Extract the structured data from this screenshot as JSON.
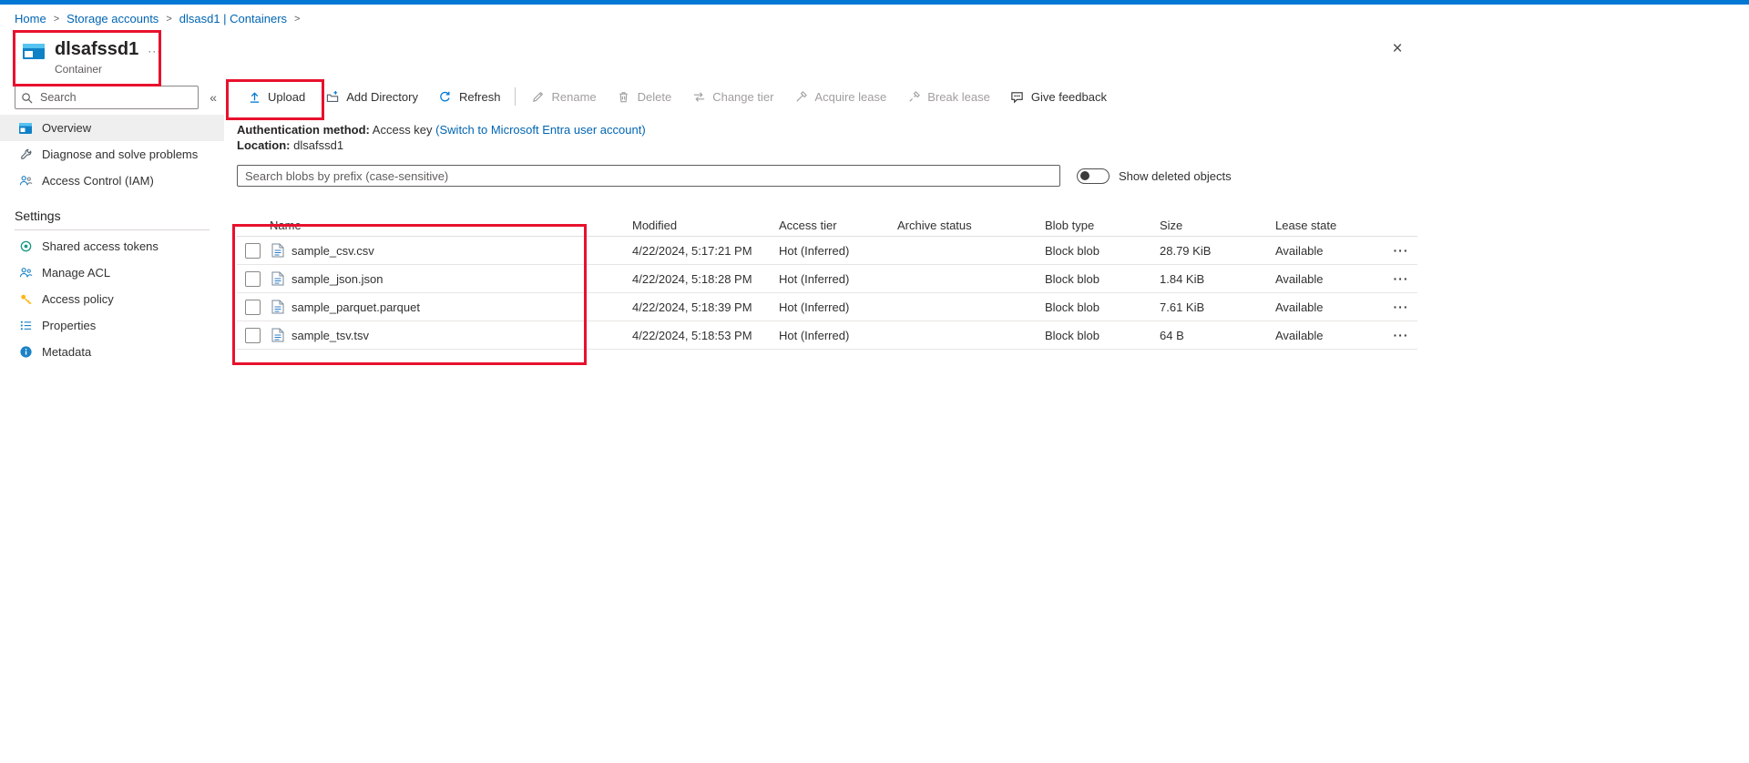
{
  "colors": {
    "accent": "#0078d4",
    "link": "#0065b3",
    "annotation_red": "#e8112d",
    "disabled_text": "#a19f9d"
  },
  "icons": {
    "close": "×",
    "more": "···",
    "collapse": "«",
    "row_actions": "···"
  },
  "breadcrumb": {
    "separator": ">",
    "items": [
      "Home",
      "Storage accounts",
      "dlsasd1 | Containers"
    ]
  },
  "header": {
    "title": "dlsafssd1",
    "subtitle": "Container"
  },
  "sidebar": {
    "search": {
      "placeholder": "Search"
    },
    "items": [
      {
        "label": "Overview"
      },
      {
        "label": "Diagnose and solve problems"
      },
      {
        "label": "Access Control (IAM)"
      }
    ],
    "settings": {
      "header": "Settings",
      "items": [
        {
          "label": "Shared access tokens"
        },
        {
          "label": "Manage ACL"
        },
        {
          "label": "Access policy"
        },
        {
          "label": "Properties"
        },
        {
          "label": "Metadata"
        }
      ]
    }
  },
  "toolbar": {
    "upload": "Upload",
    "add_directory": "Add Directory",
    "refresh": "Refresh",
    "rename": "Rename",
    "delete": "Delete",
    "change_tier": "Change tier",
    "acquire_lease": "Acquire lease",
    "break_lease": "Break lease",
    "give_feedback": "Give feedback"
  },
  "info": {
    "auth_label": "Authentication method:",
    "auth_value": "Access key",
    "auth_link": "(Switch to Microsoft Entra user account)",
    "location_label": "Location:",
    "location_value": "dlsafssd1"
  },
  "blob_filter": {
    "placeholder": "Search blobs by prefix (case-sensitive)",
    "toggle_label": "Show deleted objects"
  },
  "table": {
    "columns": [
      "Name",
      "Modified",
      "Access tier",
      "Archive status",
      "Blob type",
      "Size",
      "Lease state"
    ],
    "rows": [
      {
        "name": "sample_csv.csv",
        "modified": "4/22/2024, 5:17:21 PM",
        "access_tier": "Hot (Inferred)",
        "archive_status": "",
        "blob_type": "Block blob",
        "size": "28.79 KiB",
        "lease_state": "Available"
      },
      {
        "name": "sample_json.json",
        "modified": "4/22/2024, 5:18:28 PM",
        "access_tier": "Hot (Inferred)",
        "archive_status": "",
        "blob_type": "Block blob",
        "size": "1.84 KiB",
        "lease_state": "Available"
      },
      {
        "name": "sample_parquet.parquet",
        "modified": "4/22/2024, 5:18:39 PM",
        "access_tier": "Hot (Inferred)",
        "archive_status": "",
        "blob_type": "Block blob",
        "size": "7.61 KiB",
        "lease_state": "Available"
      },
      {
        "name": "sample_tsv.tsv",
        "modified": "4/22/2024, 5:18:53 PM",
        "access_tier": "Hot (Inferred)",
        "archive_status": "",
        "blob_type": "Block blob",
        "size": "64 B",
        "lease_state": "Available"
      }
    ]
  }
}
